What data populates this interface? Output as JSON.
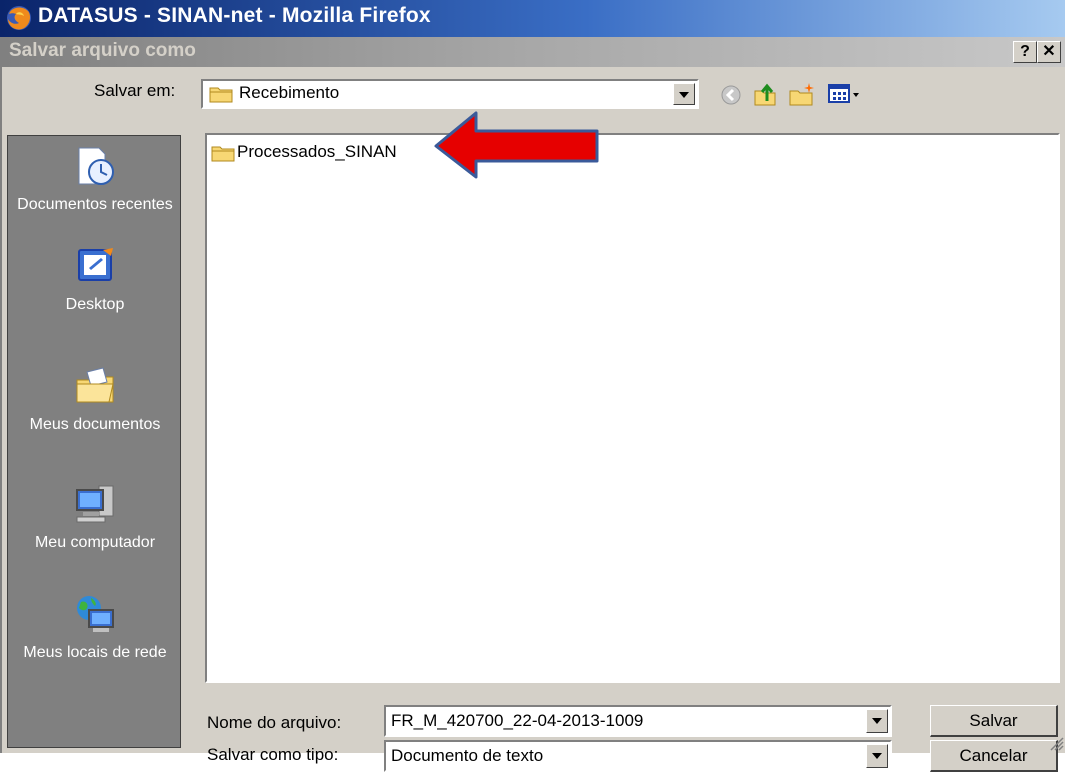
{
  "browser": {
    "title": "DATASUS - SINAN-net - Mozilla Firefox"
  },
  "dialog": {
    "title": "Salvar arquivo como",
    "help_label": "?",
    "close_label": "✕"
  },
  "save_in": {
    "label": "Salvar em:",
    "value": "Recebimento"
  },
  "places": [
    {
      "label": "Documentos recentes",
      "icon": "recent-documents-icon"
    },
    {
      "label": "Desktop",
      "icon": "desktop-icon"
    },
    {
      "label": "Meus documentos",
      "icon": "my-documents-icon"
    },
    {
      "label": "Meu computador",
      "icon": "my-computer-icon"
    },
    {
      "label": "Meus locais de rede",
      "icon": "network-places-icon"
    }
  ],
  "files": [
    {
      "name": "Processados_SINAN",
      "type": "folder"
    }
  ],
  "filename": {
    "label": "Nome do arquivo:",
    "value": "FR_M_420700_22-04-2013-1009"
  },
  "filetype": {
    "label": "Salvar como tipo:",
    "value": "Documento de texto"
  },
  "buttons": {
    "save": "Salvar",
    "cancel": "Cancelar"
  },
  "colors": {
    "title_bar": "#0a246a",
    "dialog_face": "#d4d0c8",
    "places_bar": "#808080",
    "annotation_arrow": "#e60000"
  }
}
